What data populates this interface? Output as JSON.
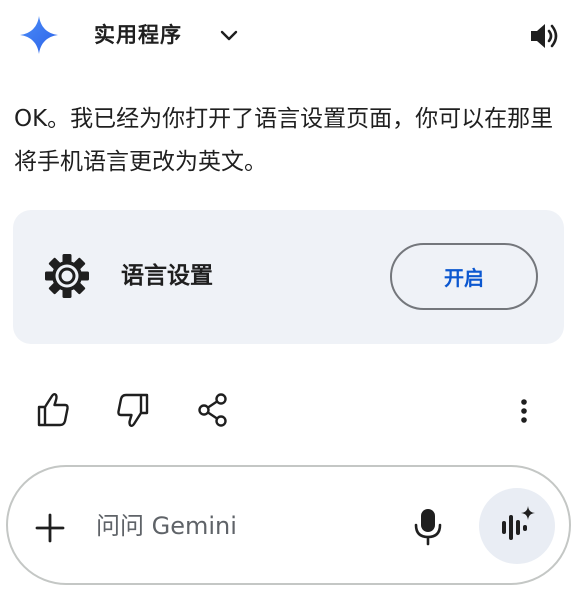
{
  "header": {
    "app_title": "实用程序",
    "logo_icon": "gemini-sparkle-icon",
    "dropdown_icon": "chevron-down-icon",
    "speaker_icon": "speaker-icon"
  },
  "message": {
    "text": "OK。我已经为你打开了语言设置页面，你可以在那里将手机语言更改为英文。"
  },
  "card": {
    "icon": "gear-icon",
    "label": "语言设置",
    "button_label": "开启"
  },
  "actions": {
    "thumb_up_icon": "thumb-up-icon",
    "thumb_down_icon": "thumb-down-icon",
    "share_icon": "share-icon",
    "more_icon": "more-vertical-icon"
  },
  "input": {
    "placeholder": "问问 Gemini",
    "plus_icon": "plus-icon",
    "mic_icon": "microphone-icon",
    "live_icon": "gemini-live-icon"
  },
  "colors": {
    "accent_blue": "#0b57d0",
    "card_bg": "#eff2f7",
    "live_bg": "#e9edf4"
  }
}
